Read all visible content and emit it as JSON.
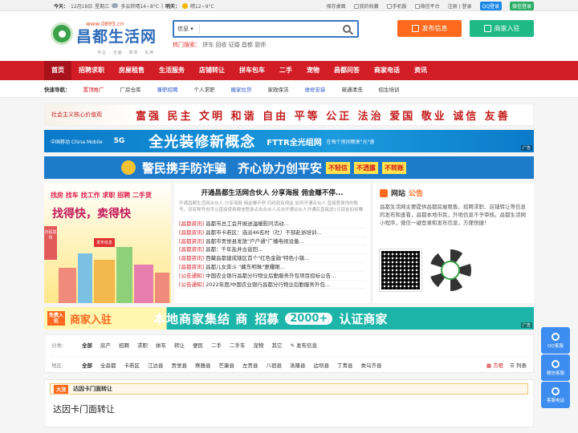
{
  "topbar": {
    "today_label": "今天：",
    "date": "12月18日",
    "weekday": "星期三",
    "today_weather": "多云转晴14~8°C",
    "tomorrow_label": "明天：",
    "tomorrow_weather": "晴12~9°C",
    "links": [
      "保存桌面",
      "我的收藏",
      "手机版",
      "微信平台"
    ],
    "register": "注册",
    "login": "登录",
    "qq_login": "QQ登录",
    "wx_login": "微信登录"
  },
  "header": {
    "domain": "www.0895.cn",
    "brand": "昌都生活网",
    "slogan": "专业 · 全面 · 简单 · 实用",
    "search_category": "信息",
    "search_placeholder": "",
    "hot_label": "热门搜索：",
    "hot_terms": "拼车 回收 征婚 昌都 厨师",
    "post_button": "发布信息",
    "join_button": "商家入驻"
  },
  "nav": [
    "首页",
    "招聘求职",
    "房屋租售",
    "生活服务",
    "店铺转让",
    "拼车包车",
    "二手",
    "宠物",
    "昌都问答",
    "商家电话",
    "资讯"
  ],
  "quick": {
    "label": "快速导航：",
    "items": [
      {
        "text": "置顶推广",
        "color": "#d31d26"
      },
      {
        "text": "厂房仓库",
        "color": "#333333"
      },
      {
        "text": "兼职招聘",
        "color": "#2c59c9"
      },
      {
        "text": "个人求职",
        "color": "#333333"
      },
      {
        "text": "搬家拉货",
        "color": "#2c59c9"
      },
      {
        "text": "家政保洁",
        "color": "#333333"
      },
      {
        "text": "维修安装",
        "color": "#2c59c9"
      },
      {
        "text": "疏通清洗",
        "color": "#333333"
      },
      {
        "text": "招生培训",
        "color": "#333333"
      }
    ]
  },
  "banner1": {
    "left": "社会主义核心价值观",
    "words": "富强 民主 文明 和谐 自由 平等 公正 法治 爱国 敬业 诚信 友善"
  },
  "banner2": {
    "carrier": "中国移动 China Mobile",
    "five_g": "5G",
    "headline": "全光装修新概念",
    "fttr": "FTTR全光组网",
    "fttr_sub": "在每个房间畅享\"光\"速",
    "ad": "广告"
  },
  "banner3": {
    "headline": "警民携手防诈骗",
    "headline2": "齐心协力创平安",
    "tags": [
      "不轻信",
      "不透露",
      "不转账"
    ]
  },
  "poster": {
    "line1": "找房 找车 找工作 求职 招聘 二手货",
    "line2": "找得快，卖得快",
    "button": "发布信息",
    "qr_label": "扫码发布"
  },
  "news": {
    "headline": "开通昌都生活网合伙人 分享海报 佣金赚不停...",
    "desc": "开通昌都生活网合伙人 分享海报 佣金赚不停 扫码就有佣金 如何开通合伙人 直接登录你的账号，没有账号也可以直接使用微信登录点击合伙人点击开通合伙人开通后直接送1元现金如何赚佣金",
    "items": [
      {
        "tag": "[昌都资讯]",
        "text": "昌都市总工会开展送温暖慰问活动..."
      },
      {
        "tag": "[昌都资讯]",
        "text": "昌都市卡若区：选派46名村（社）干部赴浙培训..."
      },
      {
        "tag": "[昌都资讯]",
        "text": "昌都市贡觉县发放\"户户通\"广播电视设备..."
      },
      {
        "tag": "[昌都资讯]",
        "text": "昌都：千年盐井古盐田..."
      },
      {
        "tag": "[昌都资讯]",
        "text": "西藏昌都建成辖区首个\"红色金融\"特色小镇..."
      },
      {
        "tag": "[昌都资讯]",
        "text": "昌都儿女奔斗 \"藏东明珠\"更耀眼..."
      },
      {
        "tag": "[公告通知]",
        "text": "中国农业银行昌都分行物业后勤服务外包项目招标公告..."
      },
      {
        "tag": "[公告通知]",
        "text": "2022年度/中国农业银行昌都分行物业后勤服务外包..."
      }
    ]
  },
  "notice": {
    "title_a": "网站",
    "title_b": "公告",
    "text": "昌都生活网主要提供昌都房屋租售、招聘求职、店铺转让等信息的发布和查看，昌都本地市民，外地信息不予审核。昌都生活网小程序，微信一键登录和发布信息，方便快捷！"
  },
  "banner4": {
    "free": "免费入驻",
    "join": "商家入驻",
    "headline": "本地商家集结 商",
    "recruit": "招募",
    "count": "2000+",
    "cert": "认证商家",
    "ad": "广告"
  },
  "filter": {
    "cat_label": "分类:",
    "categories": [
      "全部",
      "房产",
      "招聘",
      "求职",
      "拼车",
      "转让",
      "便民",
      "二手",
      "二手车",
      "宠物",
      "其它"
    ],
    "post_link": "发布信息",
    "area_label": "地区:",
    "areas": [
      "全部",
      "全昌都",
      "卡若区",
      "江达县",
      "贡觉县",
      "察雅县",
      "芒康县",
      "左贡县",
      "八宿县",
      "洛隆县",
      "边坝县",
      "丁青县",
      "类乌齐县"
    ],
    "view_grid": "方框",
    "view_list": "列表"
  },
  "list": {
    "top_badge": "大顶",
    "head": "达因卡门面转让",
    "title": "达因卡门面转让"
  },
  "side": [
    "QQ客服",
    "微信客服",
    "客服电话"
  ]
}
